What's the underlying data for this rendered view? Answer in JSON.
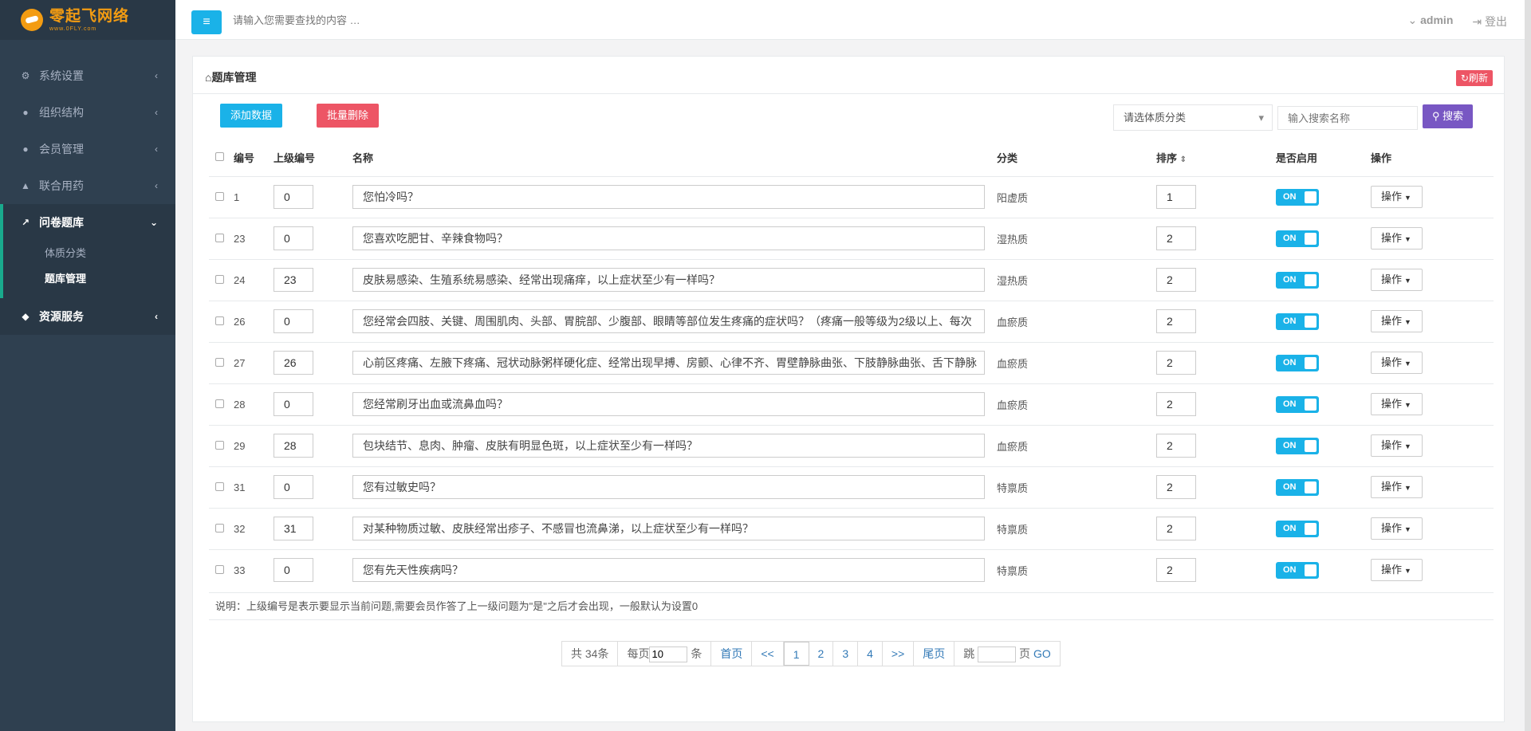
{
  "brand": {
    "name": "零起飞网络",
    "sub": "www.0FLY.com"
  },
  "sidebar": {
    "items": [
      {
        "label": "系统设置",
        "icon": "gears-icon"
      },
      {
        "label": "组织结构",
        "icon": "user-icon"
      },
      {
        "label": "会员管理",
        "icon": "users-icon"
      },
      {
        "label": "联合用药",
        "icon": "bank-icon"
      },
      {
        "label": "问卷题库",
        "icon": "line-chart-icon"
      }
    ],
    "subitems": [
      {
        "label": "体质分类"
      },
      {
        "label": "题库管理"
      }
    ],
    "service": {
      "label": "资源服务"
    }
  },
  "topbar": {
    "search_placeholder": "请输入您需要查找的内容 …",
    "user": "admin",
    "logout": "登出"
  },
  "panel": {
    "title": "题库管理",
    "refresh": "刷新",
    "add": "添加数据",
    "batch_delete": "批量删除",
    "category_select": "请选体质分类",
    "search_placeholder": "输入搜索名称",
    "search_btn": "搜索"
  },
  "table": {
    "headers": {
      "id": "编号",
      "parent": "上级编号",
      "name": "名称",
      "category": "分类",
      "sort": "排序",
      "enabled": "是否启用",
      "action": "操作"
    },
    "toggle_label": "ON",
    "op_label": "操作",
    "rows": [
      {
        "id": "1",
        "parent": "0",
        "name": "您怕冷吗？",
        "category": "阳虚质",
        "sort": "1"
      },
      {
        "id": "23",
        "parent": "0",
        "name": "您喜欢吃肥甘、辛辣食物吗？",
        "category": "湿热质",
        "sort": "2"
      },
      {
        "id": "24",
        "parent": "23",
        "name": "皮肤易感染、生殖系统易感染、经常出现痛痒，以上症状至少有一样吗？",
        "category": "湿热质",
        "sort": "2"
      },
      {
        "id": "26",
        "parent": "0",
        "name": "您经常会四肢、关键、周围肌肉、头部、胃脘部、少腹部、眼睛等部位发生疼痛的症状吗？（疼痛一般等级为2级以上、每次",
        "category": "血瘀质",
        "sort": "2"
      },
      {
        "id": "27",
        "parent": "26",
        "name": "心前区疼痛、左腋下疼痛、冠状动脉粥样硬化症、经常出现早搏、房颤、心律不齐、胃壁静脉曲张、下肢静脉曲张、舌下静脉",
        "category": "血瘀质",
        "sort": "2"
      },
      {
        "id": "28",
        "parent": "0",
        "name": "您经常刷牙出血或流鼻血吗？",
        "category": "血瘀质",
        "sort": "2"
      },
      {
        "id": "29",
        "parent": "28",
        "name": "包块结节、息肉、肿瘤、皮肤有明显色斑，以上症状至少有一样吗？",
        "category": "血瘀质",
        "sort": "2"
      },
      {
        "id": "31",
        "parent": "0",
        "name": "您有过敏史吗？",
        "category": "特禀质",
        "sort": "2"
      },
      {
        "id": "32",
        "parent": "31",
        "name": "对某种物质过敏、皮肤经常出疹子、不感冒也流鼻涕，以上症状至少有一样吗？",
        "category": "特禀质",
        "sort": "2"
      },
      {
        "id": "33",
        "parent": "0",
        "name": "您有先天性疾病吗？",
        "category": "特禀质",
        "sort": "2"
      }
    ]
  },
  "note": "说明：上级编号是表示要显示当前问题,需要会员作答了上一级问题为\"是\"之后才会出现，一般默认为设置0",
  "pagination": {
    "total": "共 34条",
    "per_page_prefix": "每页",
    "per_page_value": "10",
    "per_page_suffix": "条",
    "first": "首页",
    "prev": "<<",
    "pages": [
      "1",
      "2",
      "3",
      "4"
    ],
    "current": "1",
    "next": ">>",
    "last": "尾页",
    "jump_prefix": "跳",
    "jump_suffix": "页",
    "go": "GO"
  },
  "colors": {
    "sidebar_bg": "#2f4050",
    "primary": "#1ab2e8",
    "danger": "#ed5565",
    "search": "#7857c3",
    "accent": "#19aa8d"
  }
}
